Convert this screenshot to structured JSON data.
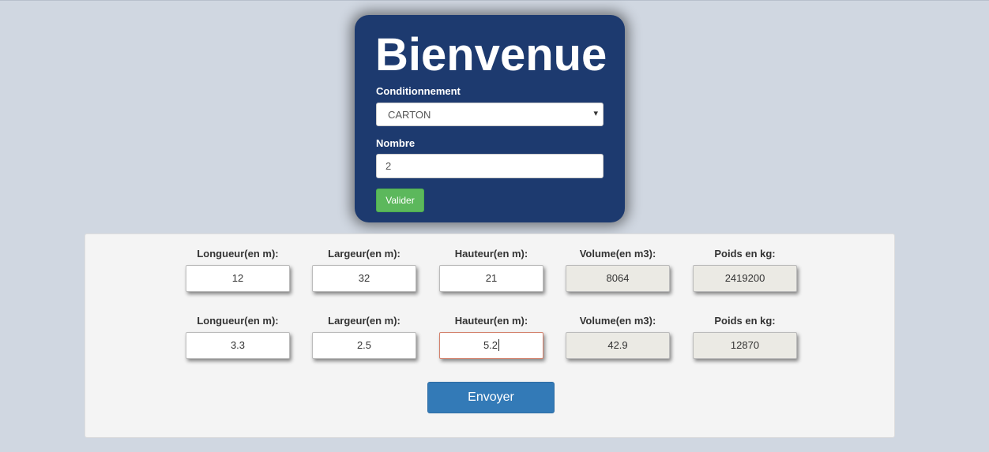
{
  "welcome": {
    "title": "Bienvenue",
    "conditionnement_label": "Conditionnement",
    "conditionnement_value": "CARTON",
    "nombre_label": "Nombre",
    "nombre_value": "2",
    "valider_label": "Valider"
  },
  "rows": [
    {
      "longueur_label": "Longueur(en m):",
      "largeur_label": "Largeur(en m):",
      "hauteur_label": "Hauteur(en m):",
      "volume_label": "Volume(en m3):",
      "poids_label": "Poids en kg:",
      "longueur": "12",
      "largeur": "32",
      "hauteur": "21",
      "volume": "8064",
      "poids": "2419200"
    },
    {
      "longueur_label": "Longueur(en m):",
      "largeur_label": "Largeur(en m):",
      "hauteur_label": "Hauteur(en m):",
      "volume_label": "Volume(en m3):",
      "poids_label": "Poids en kg:",
      "longueur": "3.3",
      "largeur": "2.5",
      "hauteur": "5.2",
      "volume": "42.9",
      "poids": "12870"
    }
  ],
  "envoyer_label": "Envoyer",
  "colors": {
    "background": "#d0d7e1",
    "card": "#1d3a6f",
    "valider": "#5cb85c",
    "envoyer": "#337ab7",
    "readonly_field": "#ebeae4"
  },
  "icons": {
    "select_arrow": "chevron-down-icon"
  }
}
